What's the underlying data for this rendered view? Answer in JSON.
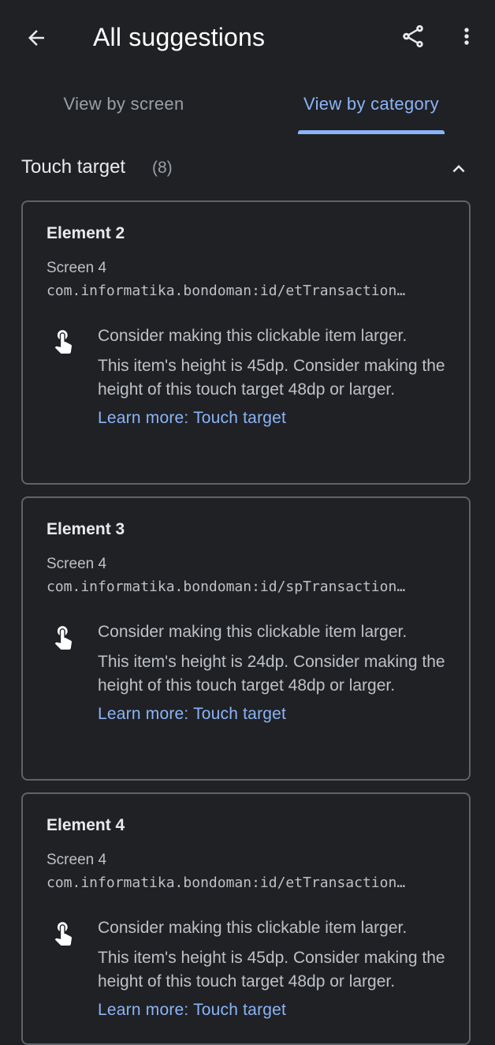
{
  "header": {
    "title": "All suggestions",
    "back_icon": "arrow-back-icon",
    "share_icon": "share-icon",
    "more_icon": "more-vert-icon"
  },
  "tabs": [
    {
      "label": "View by screen",
      "selected": false
    },
    {
      "label": "View by category",
      "selected": true
    }
  ],
  "section": {
    "title": "Touch target",
    "count": "(8)",
    "collapse_icon": "chevron-up-icon"
  },
  "cards": [
    {
      "title": "Element 2",
      "screen": "Screen 4",
      "id": "com.informatika.bondoman:id/etTransaction…",
      "message": "Consider making this clickable item larger.",
      "detail": "This item's height is 45dp. Consider making the height of this touch target 48dp or larger.",
      "link": "Learn more: Touch target",
      "icon": "touch-app-icon"
    },
    {
      "title": "Element 3",
      "screen": "Screen 4",
      "id": "com.informatika.bondoman:id/spTransaction…",
      "message": "Consider making this clickable item larger.",
      "detail": "This item's height is 24dp. Consider making the height of this touch target 48dp or larger.",
      "link": "Learn more: Touch target",
      "icon": "touch-app-icon"
    },
    {
      "title": "Element 4",
      "screen": "Screen 4",
      "id": "com.informatika.bondoman:id/etTransaction…",
      "message": "Consider making this clickable item larger.",
      "detail": "This item's height is 45dp. Consider making the height of this touch target 48dp or larger.",
      "link": "Learn more: Touch target",
      "icon": "touch-app-icon"
    }
  ],
  "colors": {
    "background": "#202124",
    "accent": "#8ab4f8",
    "text_primary": "#e8eaed",
    "text_secondary": "#bdc1c6",
    "border": "#5f6368"
  }
}
